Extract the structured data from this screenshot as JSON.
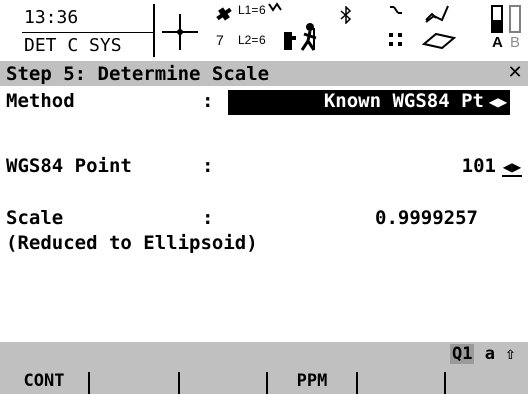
{
  "statusbar": {
    "time": "13:36",
    "coord_system": "DET C SYS",
    "satellites": {
      "l1_label": "L1=",
      "l1_count": "6",
      "l2_label": "L2=",
      "l2_count": "6",
      "visible_count": "7"
    },
    "battery_labels": [
      "A",
      "B"
    ]
  },
  "title": "Step 5: Determine Scale",
  "fields": {
    "method": {
      "label": "Method",
      "separator": ":",
      "value": "Known WGS84 Pt"
    },
    "wgs84_point": {
      "label": "WGS84 Point",
      "separator": ":",
      "value": "101"
    },
    "scale": {
      "label": "Scale",
      "separator": ":",
      "value": "0.9999257",
      "note": "(Reduced to Ellipsoid)"
    }
  },
  "input_mode": {
    "q1": "Q1",
    "case": "a",
    "shift_glyph": "⇧"
  },
  "fkeys": [
    "CONT",
    "",
    "",
    "PPM",
    "",
    ""
  ],
  "icons": [
    "crosshair-icon",
    "satellite-icon",
    "rover-icon",
    "bluetooth-icon",
    "radio-icon",
    "memory-card-icon",
    "battery-icon",
    "close-icon",
    "left-right-arrows-icon"
  ]
}
